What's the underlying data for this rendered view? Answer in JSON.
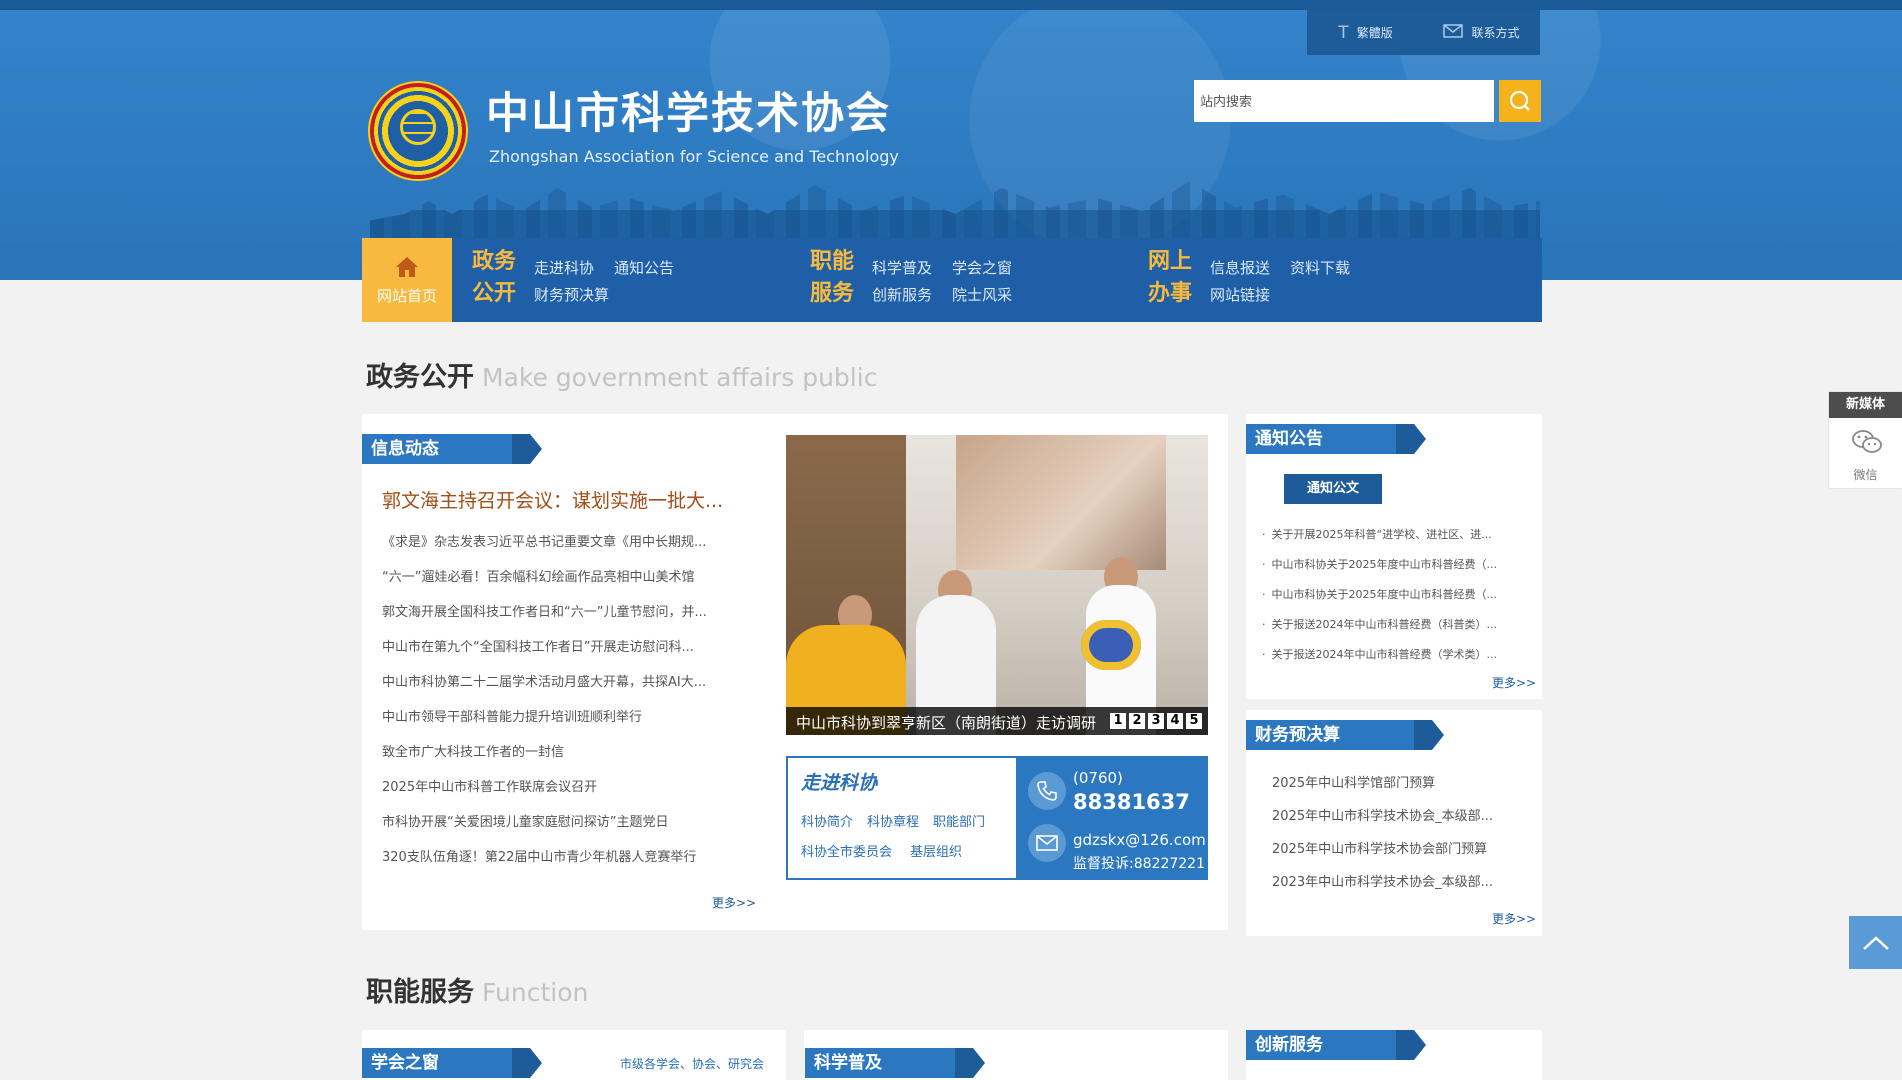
{
  "header": {
    "top_buttons": {
      "traditional": "繁體版",
      "contact": "联系方式"
    },
    "title_cn": "中山市科学技术协会",
    "title_en": "Zhongshan Association for Science and Technology",
    "search": {
      "placeholder": "站内搜索"
    }
  },
  "nav": {
    "home": "网站首页",
    "groups": [
      {
        "cat": [
          "政务",
          "公开"
        ],
        "links": [
          "走进科协",
          "通知公告",
          "财务预决算"
        ]
      },
      {
        "cat": [
          "职能",
          "服务"
        ],
        "links": [
          "科学普及",
          "学会之窗",
          "创新服务",
          "院士风采"
        ]
      },
      {
        "cat": [
          "网上",
          "办事"
        ],
        "links": [
          "信息报送",
          "资料下载",
          "网站链接"
        ]
      }
    ]
  },
  "gov": {
    "title": "政务公开",
    "title_en": "Make government affairs public",
    "news": {
      "label": "信息动态",
      "headline": "郭文海主持召开会议：谋划实施一批大...",
      "items": [
        "《求是》杂志发表习近平总书记重要文章《用中长期规...",
        "“六一”遛娃必看！百余幅科幻绘画作品亮相中山美术馆",
        "郭文海开展全国科技工作者日和“六一”儿童节慰问，并...",
        "中山市在第九个“全国科技工作者日”开展走访慰问科...",
        "中山市科协第二十二届学术活动月盛大开幕，共探AI大...",
        "中山市领导干部科普能力提升培训班顺利举行",
        "致全市广大科技工作者的一封信",
        "2025年中山市科普工作联席会议召开",
        "市科协开展“关爱困境儿童家庭慰问探访”主题党日",
        "320支队伍角逐！第22届中山市青少年机器人竞赛举行"
      ],
      "more": "更多>>"
    },
    "slider": {
      "caption": "中山市科协到翠亨新区（南朗街道）走访调研",
      "pages": [
        "1",
        "2",
        "3",
        "4",
        "5"
      ]
    },
    "zjkx": {
      "title": "走进科协",
      "links": [
        "科协简介",
        "科协章程",
        "职能部门",
        "科协全市委员会",
        "基层组织"
      ]
    },
    "contact": {
      "area_code": "(0760)",
      "phone": "88381637",
      "email": "gdzskx@126.com",
      "complaint": "监督投诉:88227221"
    },
    "notice": {
      "label": "通知公告",
      "button": "通知公文",
      "items": [
        "关于开展2025年科普“进学校、进社区、进...",
        "中山市科协关于2025年度中山市科普经费（...",
        "中山市科协关于2025年度中山市科普经费（...",
        "关于报送2024年中山市科普经费（科普类）...",
        "关于报送2024年中山市科普经费（学术类）..."
      ],
      "more": "更多>>"
    },
    "budget": {
      "label": "财务预决算",
      "items": [
        "2025年中山科学馆部门预算",
        "2025年中山市科学技术协会_本级部...",
        "2025年中山市科学技术协会部门预算",
        "2023年中山市科学技术协会_本级部..."
      ],
      "more": "更多>>"
    }
  },
  "func": {
    "title": "职能服务",
    "title_en": "Function",
    "tabs": {
      "society": "学会之窗",
      "society_desc": "市级各学会、协会、研究会",
      "popsci": "科学普及",
      "innovation": "创新服务"
    }
  },
  "side": {
    "media_head": "新媒体",
    "wechat": "微信"
  },
  "colors": {
    "brand_blue": "#2b78c0",
    "nav_blue": "#1f5fa7",
    "accent_orange": "#f8ba3e",
    "headline": "#a34e16"
  }
}
